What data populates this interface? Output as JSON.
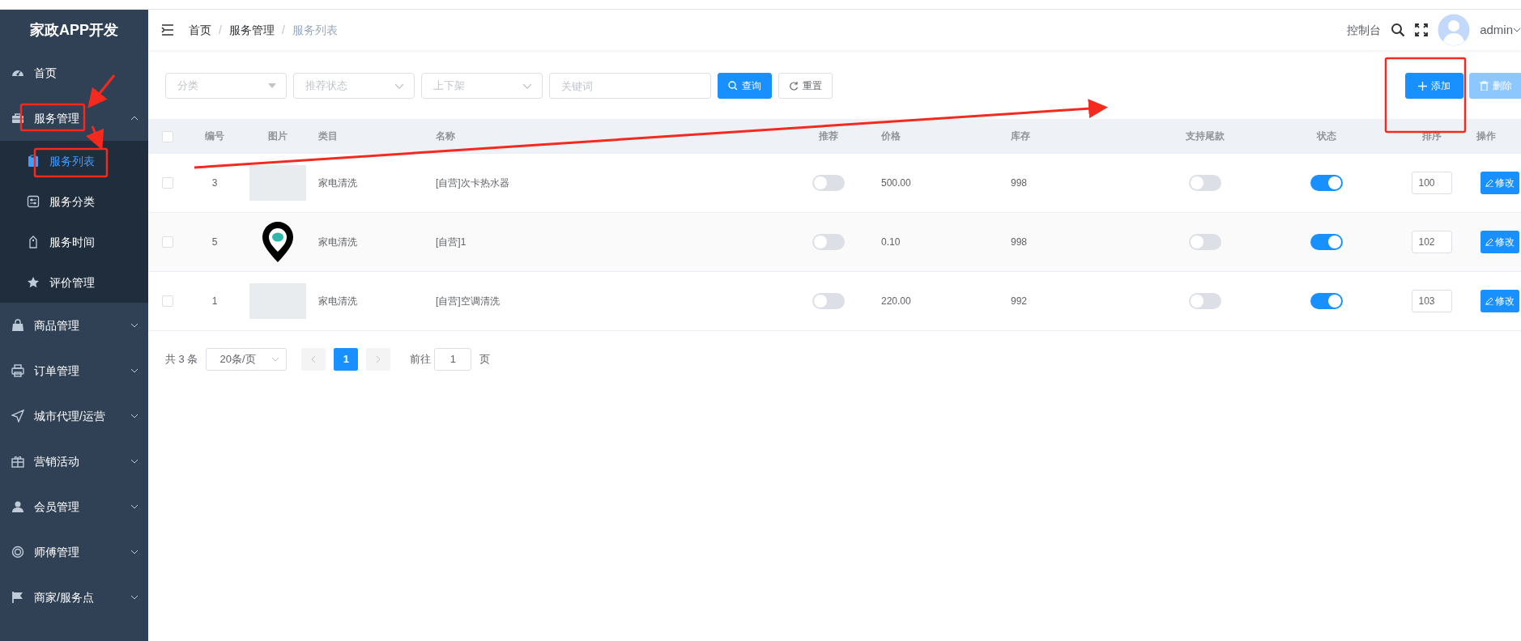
{
  "app_title": "家政APP开发",
  "sidebar": {
    "items": [
      {
        "label": "首页",
        "kind": "link"
      },
      {
        "label": "服务管理",
        "kind": "group",
        "expanded": true,
        "children": [
          {
            "label": "服务列表",
            "selected": true
          },
          {
            "label": "服务分类",
            "selected": false
          },
          {
            "label": "服务时间",
            "selected": false
          },
          {
            "label": "评价管理",
            "selected": false
          }
        ]
      },
      {
        "label": "商品管理",
        "kind": "group",
        "expanded": false
      },
      {
        "label": "订单管理",
        "kind": "group",
        "expanded": false
      },
      {
        "label": "城市代理/运营",
        "kind": "group",
        "expanded": false
      },
      {
        "label": "营销活动",
        "kind": "group",
        "expanded": false
      },
      {
        "label": "会员管理",
        "kind": "group",
        "expanded": false
      },
      {
        "label": "师傅管理",
        "kind": "group",
        "expanded": false
      },
      {
        "label": "商家/服务点",
        "kind": "group",
        "expanded": false
      }
    ]
  },
  "header": {
    "breadcrumb": [
      "首页",
      "服务管理",
      "服务列表"
    ],
    "breadcrumb_separator": "/",
    "console_link": "控制台",
    "user": "admin"
  },
  "filters": {
    "selects": [
      {
        "placeholder": "分类",
        "kind": "solid"
      },
      {
        "placeholder": "推荐状态",
        "kind": "chevron"
      },
      {
        "placeholder": "上下架",
        "kind": "chevron"
      }
    ],
    "keyword": {
      "placeholder": "关键词"
    },
    "search_button": "查询",
    "reset_button": "重置"
  },
  "actions": {
    "add_button": {
      "label": "添加",
      "disabled": false
    },
    "delete_button": {
      "label": "删除",
      "disabled": true
    }
  },
  "table": {
    "all_checked": false,
    "columns": [
      "编号",
      "图片",
      "类目",
      "名称",
      "推荐",
      "价格",
      "库存",
      "支持尾款",
      "状态",
      "排序",
      "操作"
    ],
    "rows": [
      {
        "checked": false,
        "id": "3",
        "image": {
          "kind": "photo"
        },
        "category": "家电清洗",
        "name": "[自营]次卡热水器",
        "recommended": false,
        "price": "500.00",
        "stock": "998",
        "tail_payment": false,
        "status_on": true,
        "sort": "100",
        "edit_button": "修改"
      },
      {
        "checked": false,
        "id": "5",
        "image": {
          "kind": "pin"
        },
        "category": "家电清洗",
        "name": "[自营]1",
        "recommended": false,
        "price": "0.10",
        "stock": "998",
        "tail_payment": false,
        "status_on": true,
        "sort": "102",
        "edit_button": "修改"
      },
      {
        "checked": false,
        "id": "1",
        "image": {
          "kind": "photo"
        },
        "category": "家电清洗",
        "name": "[自营]空调清洗",
        "recommended": false,
        "price": "220.00",
        "stock": "992",
        "tail_payment": false,
        "status_on": true,
        "sort": "103",
        "edit_button": "修改"
      }
    ]
  },
  "pagination": {
    "total": "共 3 条",
    "page_size": "20条/页",
    "pages": [
      {
        "label": "1",
        "selected": true
      }
    ],
    "goto_label": "前往",
    "goto_value": "1",
    "page_suffix": "页"
  }
}
